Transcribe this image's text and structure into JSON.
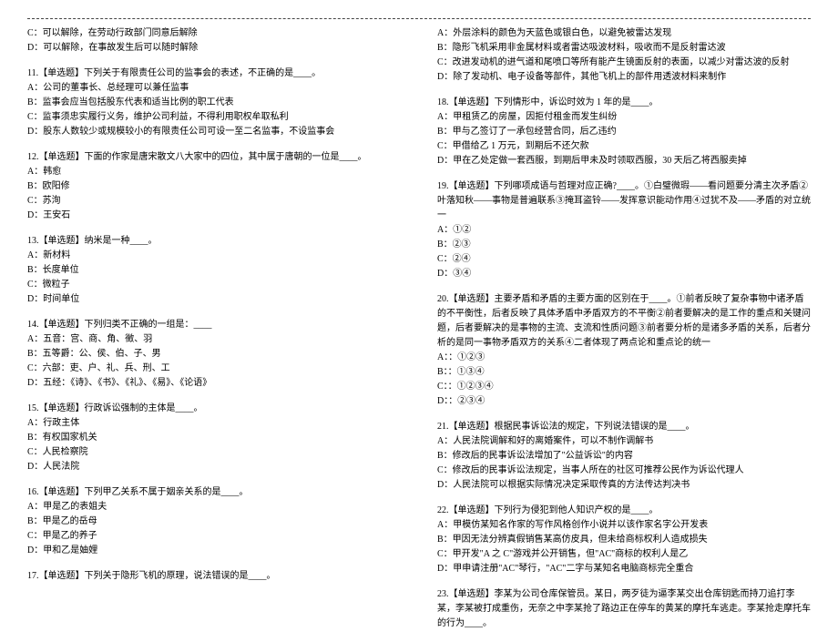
{
  "leftColumn": {
    "topOptions": [
      "C：可以解除，在劳动行政部门同意后解除",
      "D：可以解除，在事故发生后可以随时解除"
    ],
    "q11": {
      "stem": "11.【单选题】下列关于有限责任公司的监事会的表述，不正确的是____。",
      "opts": [
        "A：公司的董事长、总经理可以兼任监事",
        "B：监事会应当包括股东代表和适当比例的职工代表",
        "C：监事须忠实履行义务，维护公司利益，不得利用职权牟取私利",
        "D：股东人数较少或规模较小的有限责任公司可设一至二名监事，不设监事会"
      ]
    },
    "q12": {
      "stem": "12.【单选题】下面的作家是唐宋散文八大家中的四位，其中属于唐朝的一位是____。",
      "opts": [
        "A：韩愈",
        "B：欧阳修",
        "C：苏洵",
        "D：王安石"
      ]
    },
    "q13": {
      "stem": "13.【单选题】纳米是一种____。",
      "opts": [
        "A：新材料",
        "B：长度单位",
        "C：微粒子",
        "D：时间单位"
      ]
    },
    "q14": {
      "stem": "14.【单选题】下列归类不正确的一组是：____",
      "opts": [
        "A：五音：宫、商、角、徵、羽",
        "B：五等爵：公、侯、伯、子、男",
        "C：六部：吏、户、礼、兵、刑、工",
        "D：五经：《诗》、《书》、《礼》、《易》、《论语》"
      ]
    },
    "q15": {
      "stem": "15.【单选题】行政诉讼强制的主体是____。",
      "opts": [
        "A：行政主体",
        "B：有权国家机关",
        "C：人民检察院",
        "D：人民法院"
      ]
    },
    "q16": {
      "stem": "16.【单选题】下列甲乙关系不属于姻亲关系的是____。",
      "opts": [
        "A：甲是乙的表姐夫",
        "B：甲是乙的岳母",
        "C：甲是乙的养子",
        "D：甲和乙是妯娌"
      ]
    },
    "q17": {
      "stem": "17.【单选题】下列关于隐形飞机的原理，说法错误的是____。"
    }
  },
  "rightColumn": {
    "topOptions": [
      "A：外层涂料的颜色为天蓝色或银白色，以避免被雷达发现",
      "B：隐形飞机采用非金属材料或者雷达吸波材料，吸收而不是反射雷达波",
      "C：改进发动机的进气道和尾喷口等所有能产生镜面反射的表面，以减少对雷达波的反射",
      "D：除了发动机、电子设备等部件，其他飞机上的部件用透波材料来制作"
    ],
    "q18": {
      "stem": "18.【单选题】下列情形中，诉讼时效为 1 年的是____。",
      "opts": [
        "A：甲租赁乙的房屋，因拒付租金而发生纠纷",
        "B：甲与乙签订了一承包经营合同，后乙违约",
        "C：甲借给乙 1 万元，到期后不还欠款",
        "D：甲在乙处定做一套西服，到期后甲未及时领取西服，30 天后乙将西服卖掉"
      ]
    },
    "q19": {
      "stem": "19.【单选题】下列哪项成语与哲理对应正确?____。①白璧微瑕——看问题要分清主次矛盾②叶落知秋——事物是普遍联系③掩耳盗铃——发挥意识能动作用④过犹不及——矛盾的对立统一",
      "opts": [
        "A：①②",
        "B：②③",
        "C：②④",
        "D：③④"
      ]
    },
    "q20": {
      "stem": "20.【单选题】主要矛盾和矛盾的主要方面的区别在于____。①前者反映了复杂事物中诸矛盾的不平衡性，后者反映了具体矛盾中矛盾双方的不平衡②前者要解决的是工作的重点和关键问题，后者要解决的是事物的主流、支流和性质问题③前者要分析的是诸多矛盾的关系，后者分析的是同一事物矛盾双方的关系④二者体现了两点论和重点论的统一",
      "opts": [
        "A：：①②③",
        "B：：①③④",
        "C：：①②③④",
        "D：：②③④"
      ]
    },
    "q21": {
      "stem": "21.【单选题】根据民事诉讼法的规定，下列说法错误的是____。",
      "opts": [
        "A：人民法院调解和好的离婚案件，可以不制作调解书",
        "B：修改后的民事诉讼法增加了\"公益诉讼\"的内容",
        "C：修改后的民事诉讼法规定，当事人所在的社区可推荐公民作为诉讼代理人",
        "D：人民法院可以根据实际情况决定采取传真的方法传达判决书"
      ]
    },
    "q22": {
      "stem": "22.【单选题】下列行为侵犯到他人知识产权的是____。",
      "opts": [
        "A：甲模仿某知名作家的写作风格创作小说并以该作家名字公开发表",
        "B：甲因无法分辨真假销售某高仿皮具，但未给商标权利人造成损失",
        "C：甲开发\"A 之 C\"游戏并公开销售，但\"AC\"商标的权利人是乙",
        "D：甲申请注册\"AC\"琴行，\"AC\"二字与某知名电脑商标完全重合"
      ]
    },
    "q23": {
      "stem": "23.【单选题】李某为公司仓库保管员。某日，两歹徒为逼李某交出仓库钥匙而持刀追打李某，李某被打成重伤，无奈之中李某抢了路边正在停车的黄某的摩托车逃走。李某抢走摩托车的行为____。"
    }
  }
}
